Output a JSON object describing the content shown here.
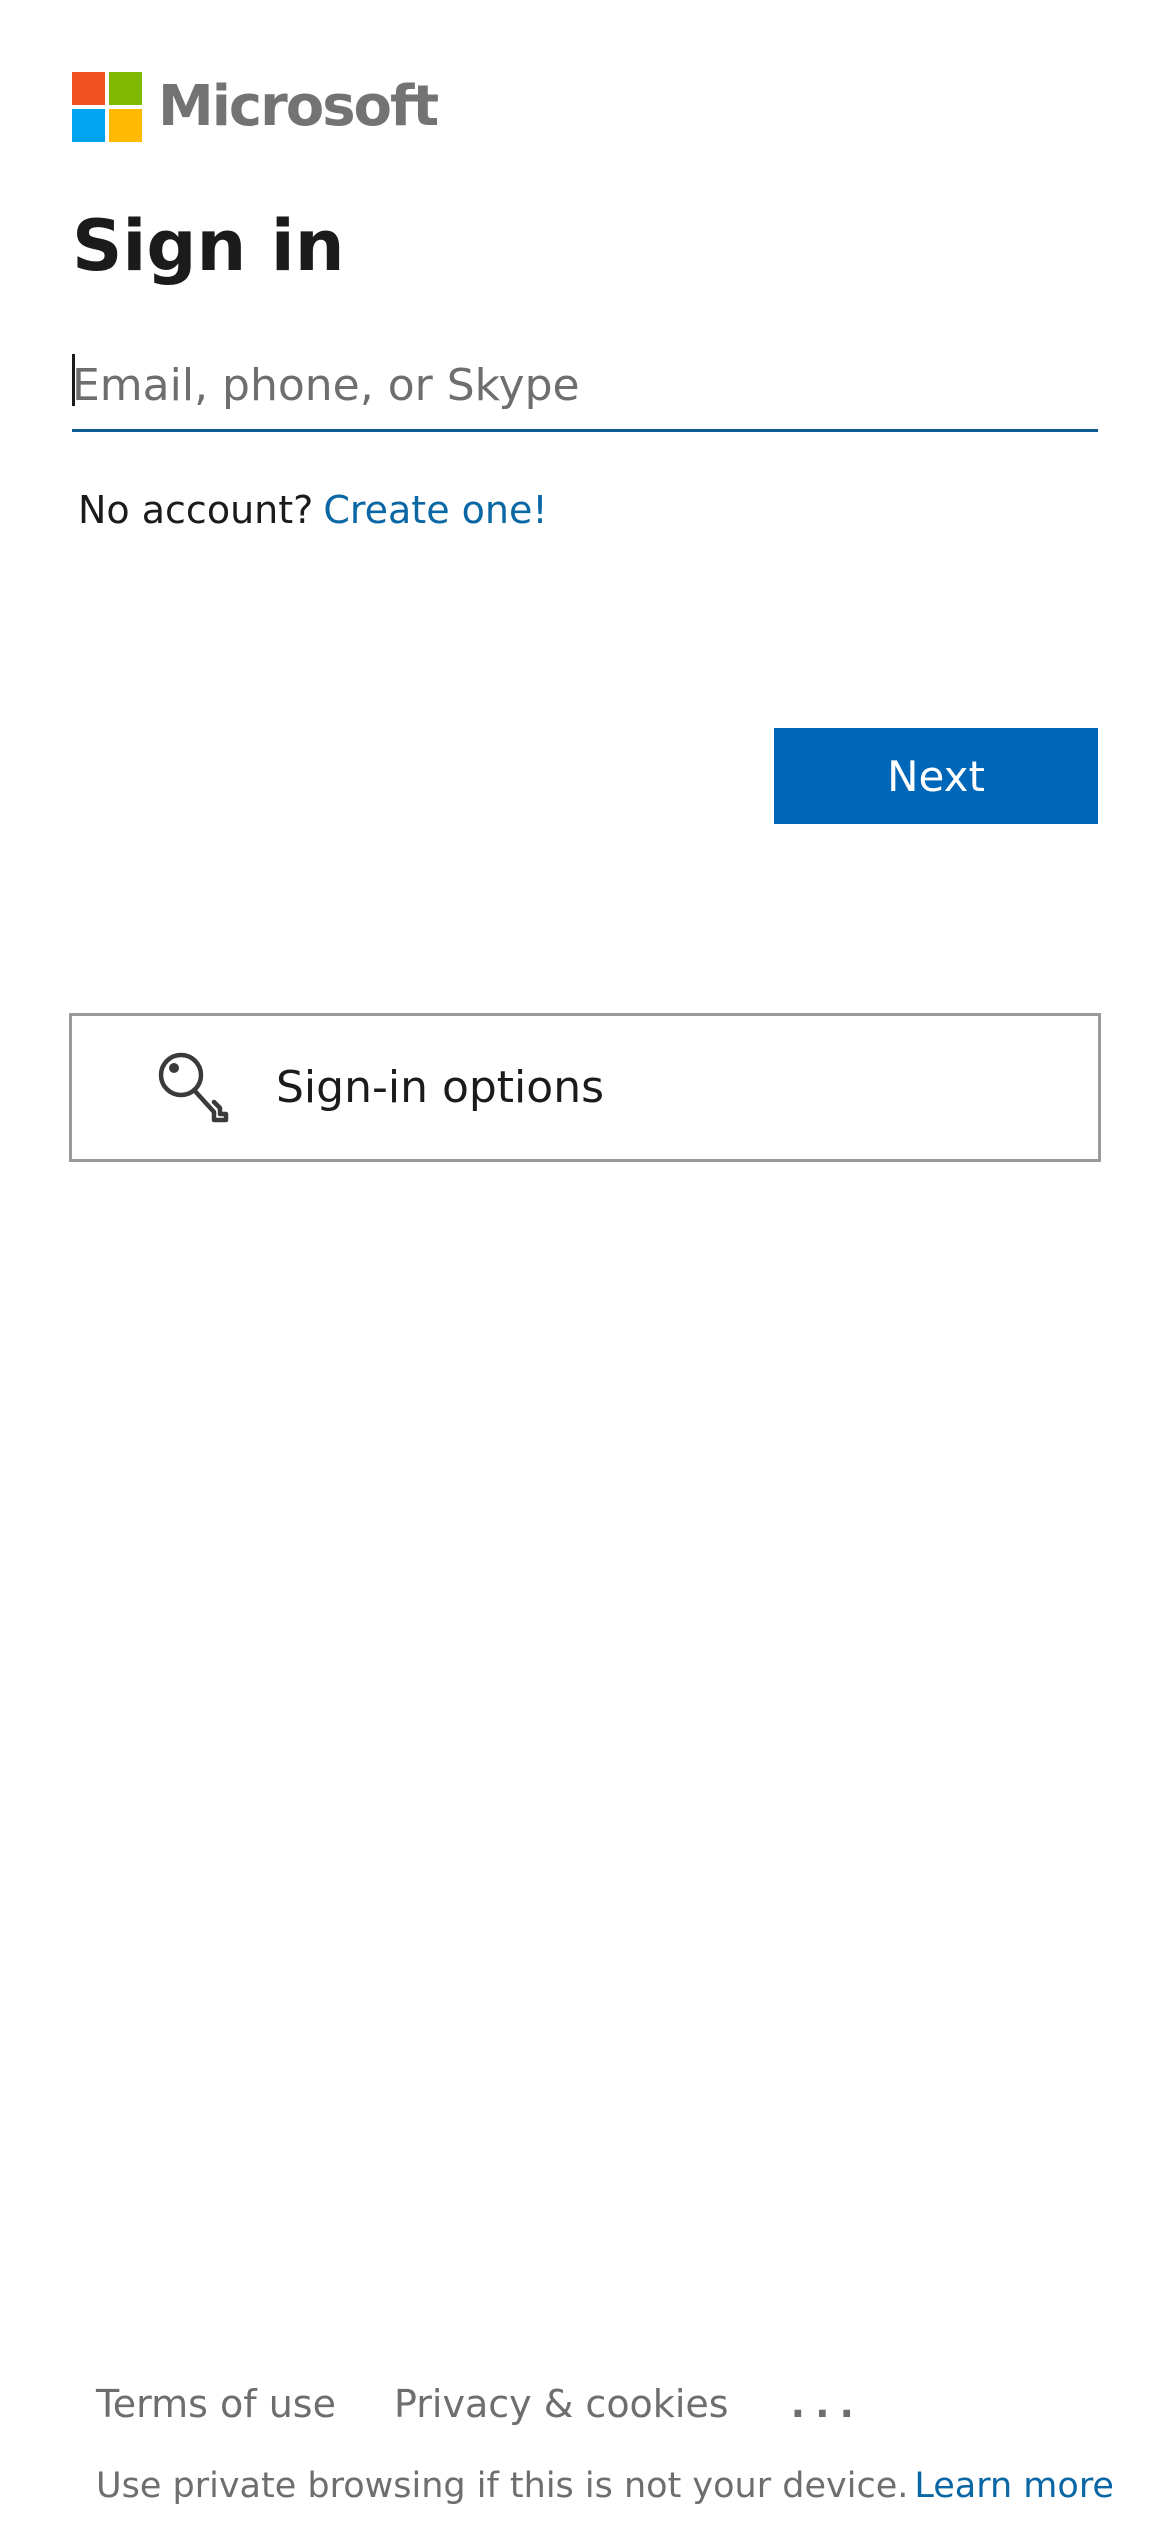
{
  "brand": {
    "name": "Microsoft",
    "colors": {
      "red": "#f25022",
      "green": "#7fba00",
      "blue": "#00a4ef",
      "yellow": "#ffb900"
    }
  },
  "signin": {
    "title": "Sign in",
    "email_placeholder": "Email, phone, or Skype",
    "email_value": "",
    "no_account_text": "No account?",
    "create_link": "Create one!",
    "next_label": "Next",
    "options_label": "Sign-in options",
    "options_icon": "key-icon"
  },
  "footer": {
    "terms": "Terms of use",
    "privacy": "Privacy & cookies",
    "more": "...",
    "private_note": "Use private browsing if this is not your device.",
    "learn_more": "Learn more"
  },
  "colors": {
    "accent": "#0067b8",
    "link": "#0a67a5",
    "underline": "#0b5a93",
    "muted": "#6e6e6e"
  }
}
